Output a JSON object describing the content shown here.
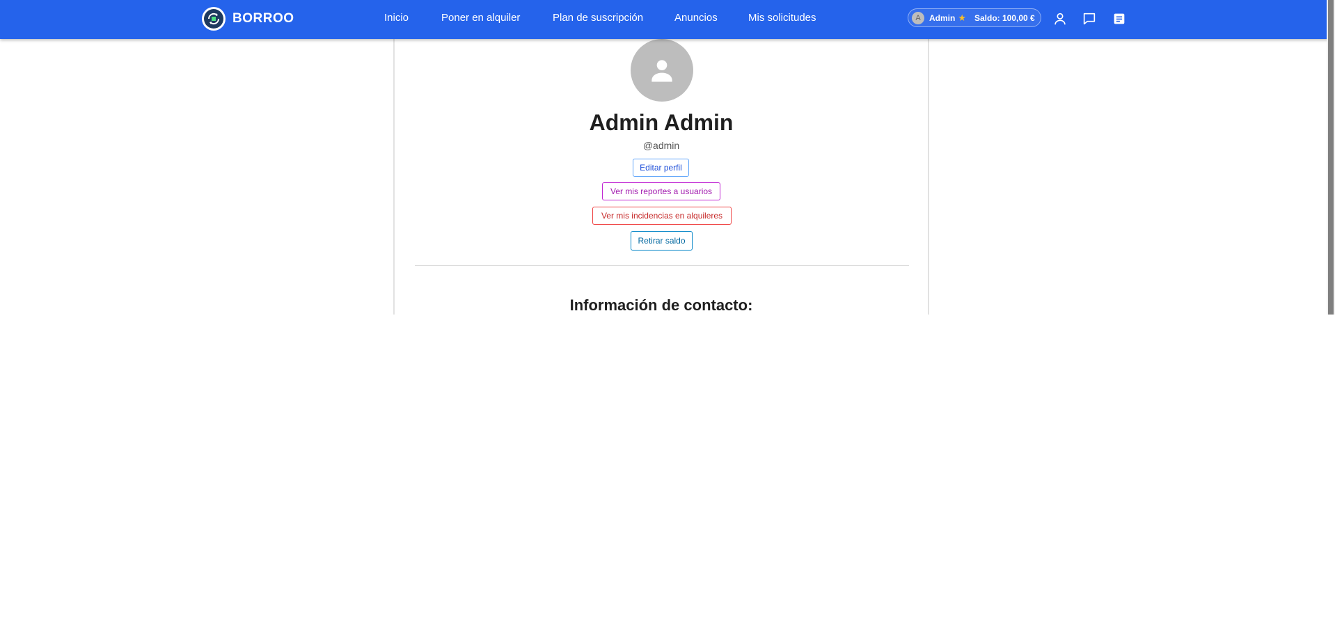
{
  "header": {
    "brand_name": "BORROO",
    "nav": [
      {
        "label": "Inicio"
      },
      {
        "label": "Poner en alquiler"
      },
      {
        "label": "Plan de suscripción"
      },
      {
        "label": "Anuncios"
      },
      {
        "label": "Mis solicitudes"
      }
    ],
    "user_pill": {
      "avatar_initial": "A",
      "name": "Admin",
      "star_icon": "star-icon",
      "balance": "Saldo: 100,00 €"
    },
    "icons": [
      "profile-icon",
      "chat-icon",
      "notes-icon"
    ]
  },
  "profile": {
    "full_name": "Admin Admin",
    "username": "@admin",
    "buttons": {
      "edit": "Editar perfil",
      "reports": "Ver mis reportes a usuarios",
      "incidents": "Ver mis incidencias en alquileres",
      "withdraw": "Retirar saldo"
    },
    "contact_title": "Información de contacto:"
  },
  "colors": {
    "header_bg": "#2563eb",
    "avatar_bg": "#bdbdbd",
    "edit_accent": "#1d4ed8",
    "reports_accent": "#a21caf",
    "incidents_accent": "#c62828",
    "withdraw_accent": "#0369a1"
  }
}
